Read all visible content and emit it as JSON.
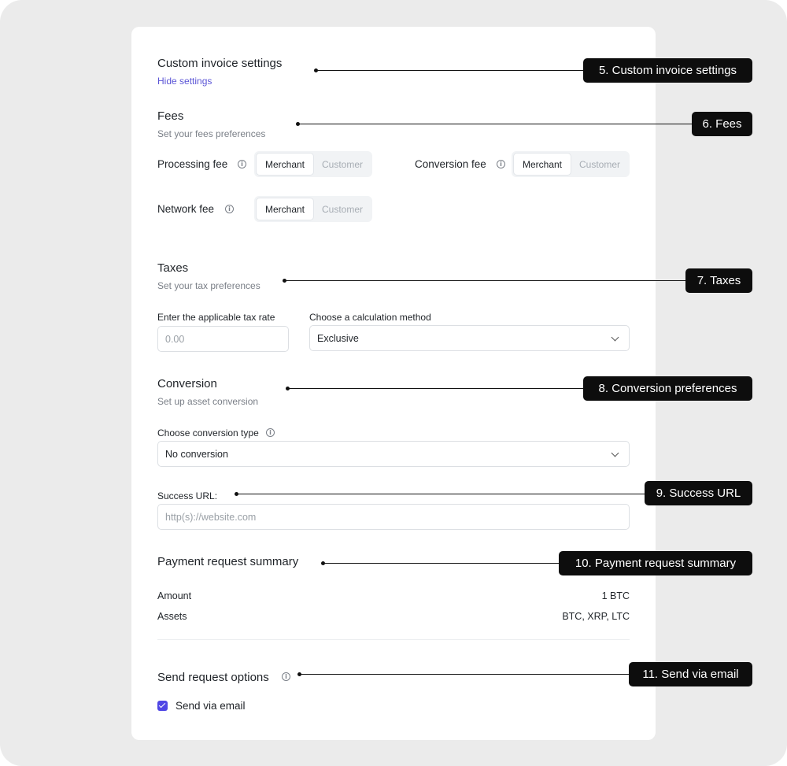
{
  "invoice_settings": {
    "title": "Custom invoice settings",
    "hide_link": "Hide settings"
  },
  "fees": {
    "title": "Fees",
    "subtitle": "Set your fees preferences",
    "processing": {
      "label": "Processing fee",
      "options": [
        "Merchant",
        "Customer"
      ],
      "selected": "Merchant"
    },
    "conversion": {
      "label": "Conversion fee",
      "options": [
        "Merchant",
        "Customer"
      ],
      "selected": "Merchant"
    },
    "network": {
      "label": "Network fee",
      "options": [
        "Merchant",
        "Customer"
      ],
      "selected": "Merchant"
    },
    "info_icon": "info-icon"
  },
  "taxes": {
    "title": "Taxes",
    "subtitle": "Set your tax preferences",
    "rate_label": "Enter the applicable tax rate",
    "rate_placeholder": "0.00",
    "method_label": "Choose a calculation method",
    "method_value": "Exclusive"
  },
  "conversion": {
    "title": "Conversion",
    "subtitle": "Set up asset conversion",
    "type_label": "Choose conversion type",
    "type_value": "No conversion"
  },
  "success_url": {
    "label": "Success URL:",
    "placeholder": "http(s)://website.com"
  },
  "summary": {
    "title": "Payment request summary",
    "rows": [
      {
        "label": "Amount",
        "value": "1 BTC"
      },
      {
        "label": "Assets",
        "value": "BTC, XRP, LTC"
      }
    ]
  },
  "send_options": {
    "title": "Send request options",
    "email_label": "Send via email",
    "email_checked": true
  },
  "callouts": [
    "5. Custom invoice settings",
    "6. Fees",
    "7. Taxes",
    "8. Conversion preferences",
    "9. Success URL",
    "10. Payment request summary",
    "11. Send via email"
  ],
  "colors": {
    "accent": "#4f46e5",
    "link": "#5b55d6",
    "callout_bg": "#0d0d0d",
    "frame_bg": "#ebebeb"
  }
}
